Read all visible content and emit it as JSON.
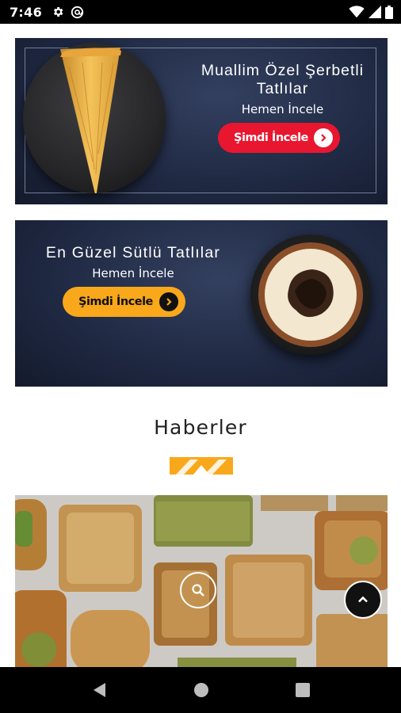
{
  "status_bar": {
    "time": "7:46",
    "left_icons": [
      "gear-icon",
      "at-sign-icon"
    ],
    "right_icons": [
      "wifi-icon",
      "cell-signal-icon",
      "battery-icon"
    ]
  },
  "banners": [
    {
      "title_line1": "Muallim Özel Şerbetli",
      "title_line2": "Tatlılar",
      "subtitle": "Hemen İncele",
      "button_label": "Şimdi İncele",
      "button_color": "#e8162f"
    },
    {
      "title": "En Güzel Sütlü Tatlılar",
      "subtitle": "Hemen İncele",
      "button_label": "Şimdi İncele",
      "button_color": "#f9a81b"
    }
  ],
  "news_section": {
    "title": "Haberler",
    "divider_color": "#f9a81b"
  },
  "news_card": {
    "icon": "search-icon"
  },
  "scroll_top_icon": "chevron-up-icon",
  "nav_bar": [
    "back-icon",
    "home-icon",
    "recents-icon"
  ]
}
